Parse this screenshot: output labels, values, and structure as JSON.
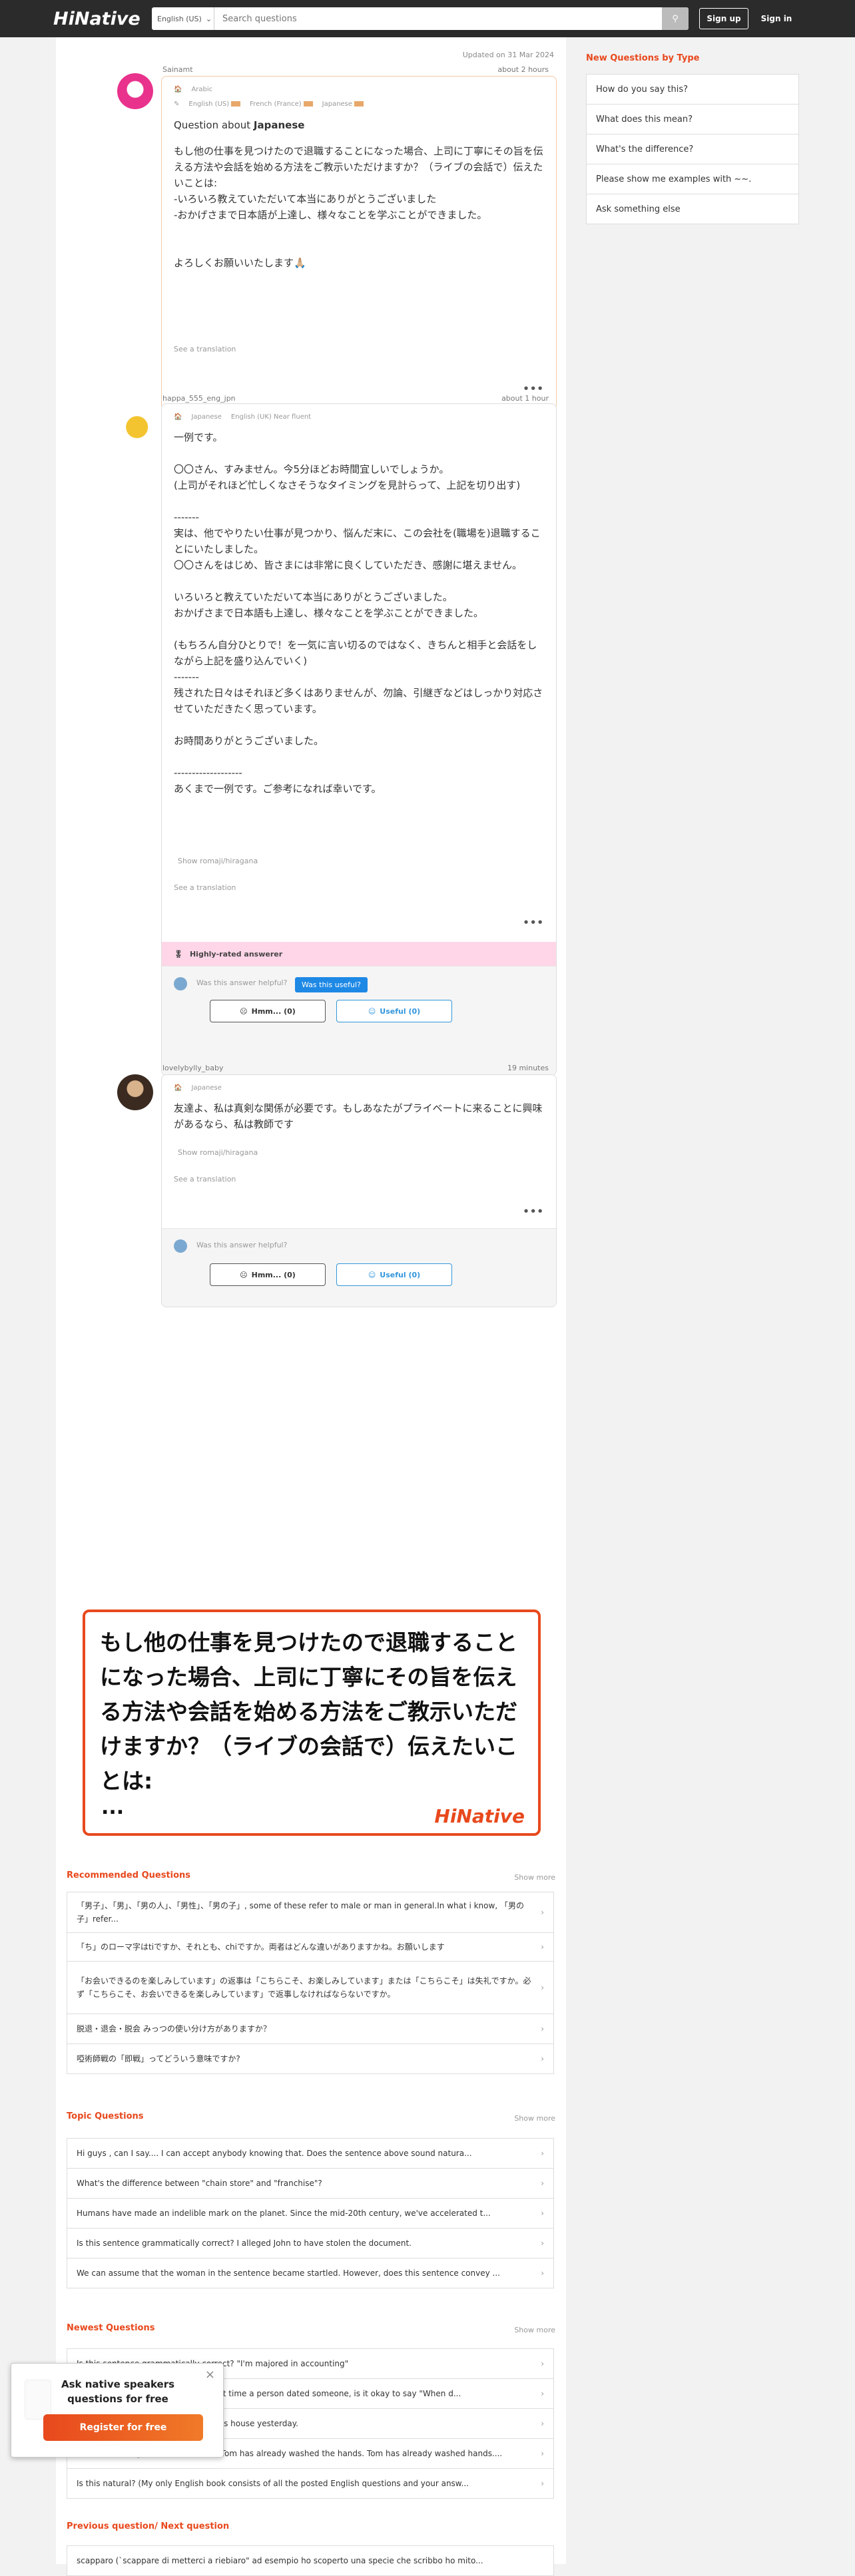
{
  "header": {
    "logo": "HiNative",
    "lang": "English (US)",
    "search_placeholder": "Search questions",
    "signup": "Sign up",
    "signin": "Sign in"
  },
  "updated": "Updated on 31 Mar 2024",
  "question": {
    "user": "Sainamt",
    "time": "about 2 hours",
    "native_tag": "Arabic",
    "learning_tags": [
      "English (US)",
      "French (France)",
      "Japanese"
    ],
    "title_prefix": "Question about",
    "title_lang": "Japanese",
    "body": "もし他の仕事を見つけたので退職することになった場合、上司に丁寧にその旨を伝える方法や会話を始める方法をご教示いただけますか？（ライブの会話で）伝えたいことは:\n-いろいろ教えていただいて本当にありがとうございました\n-おかげさまで日本語が上達し、様々なことを学ぶことができました。\n\n\nよろしくお願いいたします🙏🏼",
    "see_translation": "See a translation"
  },
  "answer1": {
    "user": "happa_555_eng_jpn",
    "time": "about 1 hour",
    "tags": [
      "Japanese",
      "English (UK) Near fluent"
    ],
    "body": "一例です。\n\n〇〇さん、すみません。今5分ほどお時間宜しいでしょうか。\n(上司がそれほど忙しくなさそうなタイミングを見計らって、上記を切り出す)\n\n-------\n実は、他でやりたい仕事が見つかり、悩んだ末に、この会社を(職場を)退職することにいたしました。\n〇〇さんをはじめ、皆さまには非常に良くしていただき、感謝に堪えません。\n\nいろいろと教えていただいて本当にありがとうございました。\nおかげさまで日本語も上達し、様々なことを学ぶことができました。\n\n(もちろん自分ひとりで！を一気に言い切るのではなく、きちんと相手と会話をしながら上記を盛り込んでいく)\n-------\n残された日々はそれほど多くはありませんが、勿論、引継ぎなどはしっかり対応させていただきたく思っています。\n\nお時間ありがとうございました。\n\n-------------------\nあくまで一例です。ご参考になれば幸いです。",
    "romaji": "Show romaji/hiragana",
    "see_translation": "See a translation",
    "badge": "Highly-rated answerer",
    "helpful_q": "Was this answer helpful?",
    "tooltip": "Was this useful?",
    "hmm": "Hmm... (0)",
    "useful": "Useful (0)"
  },
  "answer2": {
    "user": "lovelybylly_baby",
    "time": "19 minutes",
    "tags": [
      "Japanese"
    ],
    "body": "友達よ、私は真剣な関係が必要です。もしあなたがプライベートに来ることに興味があるなら、私は教師です",
    "romaji": "Show romaji/hiragana",
    "see_translation": "See a translation",
    "helpful_q": "Was this answer helpful?",
    "hmm": "Hmm... (0)",
    "useful": "Useful (0)"
  },
  "banner": {
    "text": "もし他の仕事を見つけたので退職することになった場合、上司に丁寧にその旨を伝える方法や会話を始める方法をご教示いただけますか？（ライブの会話で）伝えたいことは:",
    "ellipsis": "...",
    "logo": "HiNative"
  },
  "sidebar": {
    "title": "New Questions by Type",
    "items": [
      "How do you say this?",
      "What does this mean?",
      "What's the difference?",
      "Please show me examples with ~~.",
      "Ask something else"
    ]
  },
  "recommended": {
    "title": "Recommended Questions",
    "show_more": "Show more",
    "items": [
      "「男子」、「男」、「男の人」、「男性」、「男の子」, some of these refer to male or man in general.In what i know, 「男の子」refer...",
      "「ち」のローマ字はtiですか、それとも、chiですか。両者はどんな違いがありますかね。お願いします",
      "「お会いできるのを楽しみしています」の返事は「こちらこそ、お楽しみしています」または「こちらこそ」は失礼ですか。必ず「こちらこそ、お会いできるを楽しみしています」で返事しなければならないですか。",
      "脱退・退会・脱会 みっつの使い分け方がありますか？",
      "啞術師戦の「即戦」ってどういう意味ですか?"
    ]
  },
  "topic": {
    "title": "Topic Questions",
    "show_more": "Show more",
    "items": [
      "Hi guys , can I say.... I can accept anybody knowing that. Does the sentence above sound natura...",
      "What's the difference between \"chain store\" and \"franchise\"?",
      "Humans have made an indelible mark on the planet. Since the mid-20th century, we've accelerated t...",
      "Is this sentence grammatically correct? I alleged John to have stolen the document.",
      "We can assume that the woman in the sentence became startled. However, does this sentence convey ..."
    ]
  },
  "newest": {
    "title": "Newest Questions",
    "show_more": "Show more",
    "items": [
      "Is this sentence grammatically correct? \"I'm majored in accounting\"",
      "If it hasn't been a while since the last time a person dated someone, is it okay to say \"When d...",
      "I washed my car so good I went to his house yesterday.",
      "Tom has already washed his hands. Tom has already washed the hands. Tom has already washed hands....",
      "Is this natural? (My only English book consists of all the posted English questions and your answ..."
    ]
  },
  "prevnext": {
    "title": "Previous question/ Next question",
    "item": "scapparo (`scappare di metterci a riebiaro\" ad esempio ho scoperto una specie che scribbo ho mito..."
  },
  "popup": {
    "title": "Ask native speakers questions for free",
    "button": "Register for free"
  },
  "colors": {
    "accent": "#e8491d",
    "link": "#3296dc",
    "highlight": "#ffd6e8"
  }
}
